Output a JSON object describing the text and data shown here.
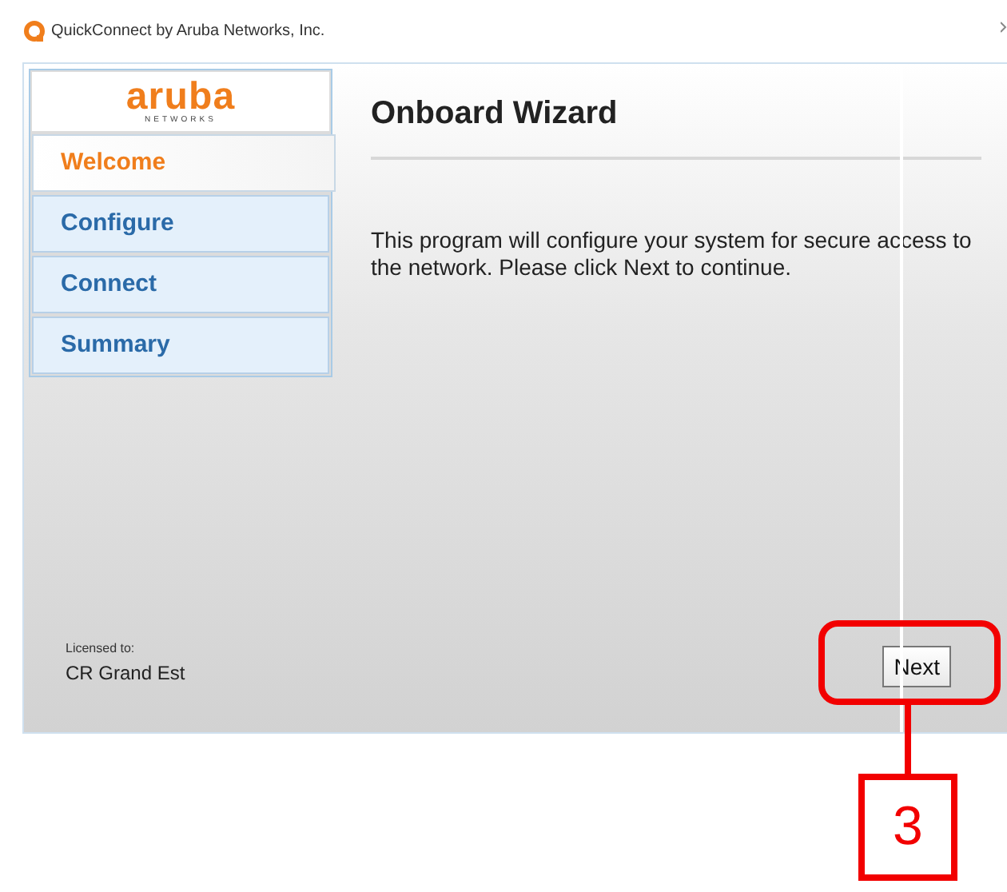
{
  "window": {
    "title": "QuickConnect by Aruba Networks, Inc."
  },
  "logo": {
    "name": "aruba",
    "subtitle": "NETWORKS"
  },
  "steps": [
    {
      "label": "Welcome",
      "selected": true
    },
    {
      "label": "Configure",
      "selected": false
    },
    {
      "label": "Connect",
      "selected": false
    },
    {
      "label": "Summary",
      "selected": false
    }
  ],
  "page": {
    "heading": "Onboard Wizard",
    "message": "This program will configure your system for secure access to the network. Please click Next to continue."
  },
  "license": {
    "caption": "Licensed to:",
    "holder": "CR Grand Est"
  },
  "buttons": [
    "Next"
  ],
  "callout": {
    "number": "3"
  }
}
